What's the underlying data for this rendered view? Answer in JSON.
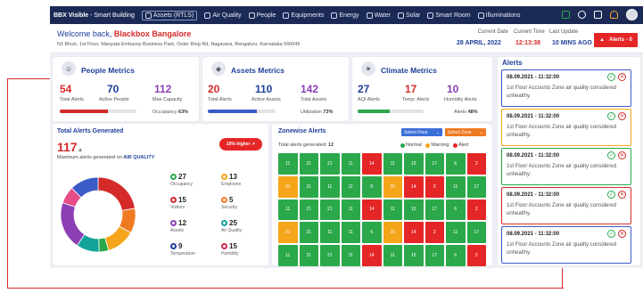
{
  "nav": {
    "brand_bold": "BBX Visible",
    "brand_rest": " - Smart Building",
    "tabs": [
      {
        "label": "Assets (RTLS)",
        "icon": "asset-icon"
      },
      {
        "label": "Air Quality",
        "icon": "wind-icon"
      },
      {
        "label": "People",
        "icon": "people-icon"
      },
      {
        "label": "Equipments",
        "icon": "equipment-icon"
      },
      {
        "label": "Energy",
        "icon": "energy-icon"
      },
      {
        "label": "Water",
        "icon": "water-icon"
      },
      {
        "label": "Solar",
        "icon": "solar-icon"
      },
      {
        "label": "Smart Room",
        "icon": "room-icon"
      },
      {
        "label": "Illuminations",
        "icon": "light-icon"
      }
    ]
  },
  "header": {
    "welcome_prefix": "Welcome back, ",
    "org": "Blackbox Bangalore",
    "address": "N1 Block, 1st Floor, Manyata Embassy Business Park, Outer Ring Rd, Nagavara, Bengaluru, Karnataka 560045",
    "current_date_label": "Current Date",
    "current_date": "28 APRIL, 2022",
    "current_time_label": "Current Time",
    "current_time": "12:13:38",
    "last_update_label": "Last Update",
    "last_update": "10 MINS AGO",
    "alerts_button": "Alerts - 0"
  },
  "people": {
    "title": "People Metrics",
    "total_alerts": "54",
    "total_alerts_label": "Total Alerts",
    "active": "70",
    "active_label": "Active People",
    "max": "112",
    "max_label": "Max Capacity",
    "occupancy_label": "Occupancy",
    "occupancy": "63%",
    "occupancy_fraction": 0.63
  },
  "assets": {
    "title": "Assets Metrics",
    "total_alerts": "20",
    "total_alerts_label": "Total Alerts",
    "active": "110",
    "active_label": "Active Assets",
    "total": "142",
    "total_label": "Total Assets",
    "util_label": "Utilization",
    "util": "73%",
    "util_fraction": 0.73
  },
  "climate": {
    "title": "Climate Metrics",
    "aqi": "27",
    "aqi_label": "AQI Alerts",
    "temp": "17",
    "temp_label": "Temp. Alerts",
    "hum": "10",
    "hum_label": "Humidity Alerts",
    "alerts_label": "Alerts",
    "alerts": "48%",
    "alerts_fraction": 0.48
  },
  "total_alerts": {
    "title": "Total Alerts Generated",
    "value": "117",
    "max_text": "Maximum alerts generated on ",
    "max_category": "AIR QUALITY",
    "higher": "10% higher",
    "items": [
      {
        "num": "27",
        "label": "Occupancy",
        "color": "#2aa84a"
      },
      {
        "num": "13",
        "label": "Employee",
        "color": "#f5a51a"
      },
      {
        "num": "15",
        "label": "Visitors",
        "color": "#d42a2a"
      },
      {
        "num": "5",
        "label": "Security",
        "color": "#f07a22"
      },
      {
        "num": "12",
        "label": "Assets",
        "color": "#8b3fb5"
      },
      {
        "num": "25",
        "label": "Air Quality",
        "color": "#14a39a"
      },
      {
        "num": "9",
        "label": "Temperature",
        "color": "#1f3f9a"
      },
      {
        "num": "15",
        "label": "Humidity",
        "color": "#d42a4f"
      }
    ]
  },
  "zonewise": {
    "title": "Zonewise Alerts",
    "floor_select": "Select Floor",
    "zone_select": "Select Zone",
    "generated_label": "Total alerts generated: ",
    "generated": "12",
    "legend_normal": "Normal",
    "legend_warning": "Warning",
    "legend_alert": "Alert",
    "rows": [
      [
        "11",
        "21",
        "21",
        "11",
        "14",
        "11",
        "15",
        "17",
        "6",
        "2"
      ],
      [
        "21",
        "21",
        "11",
        "11",
        "6",
        "15",
        "14",
        "2",
        "11",
        "17"
      ],
      [
        "11",
        "21",
        "21",
        "11",
        "14",
        "11",
        "15",
        "17",
        "6",
        "2"
      ],
      [
        "21",
        "21",
        "11",
        "11",
        "6",
        "15",
        "14",
        "2",
        "11",
        "17"
      ],
      [
        "11",
        "21",
        "21",
        "11",
        "14",
        "11",
        "15",
        "17",
        "6",
        "2"
      ]
    ],
    "row_colors": [
      [
        "g",
        "g",
        "g",
        "g",
        "r",
        "g",
        "g",
        "g",
        "g",
        "r"
      ],
      [
        "o",
        "g",
        "g",
        "g",
        "g",
        "o",
        "r",
        "r",
        "g",
        "g"
      ],
      [
        "g",
        "g",
        "g",
        "g",
        "r",
        "g",
        "g",
        "g",
        "g",
        "r"
      ],
      [
        "o",
        "g",
        "g",
        "g",
        "g",
        "o",
        "r",
        "r",
        "g",
        "g"
      ],
      [
        "g",
        "g",
        "g",
        "g",
        "r",
        "g",
        "g",
        "g",
        "g",
        "r"
      ]
    ]
  },
  "alerts": {
    "title": "Alerts",
    "items": [
      {
        "time": "08.09.2021 - 11:32:00",
        "msg": "1st Floor Accounts Zone air quality considered unhealthy.",
        "border": "#3b5bc6"
      },
      {
        "time": "08.09.2021 - 11:32:00",
        "msg": "1st Floor Accounts Zone air quality considered unhealthy.",
        "border": "#f5a51a"
      },
      {
        "time": "08.09.2021 - 11:32:00",
        "msg": "1st Floor Accounts Zone air quality considered unhealthy.",
        "border": "#2aa84a"
      },
      {
        "time": "08.09.2021 - 11:32:00",
        "msg": "1st Floor Accounts Zone air quality considered unhealthy.",
        "border": "#d42a2a"
      },
      {
        "time": "08.09.2021 - 11:32:00",
        "msg": "1st Floor Accounts Zone air quality considered unhealthy.",
        "border": "#3b5bc6"
      }
    ]
  },
  "colors": {
    "normal": "#2aa84a",
    "warning": "#f5a51a",
    "alert": "#e52626",
    "nav": "#1b2a55",
    "accent": "#1f3f9a"
  }
}
